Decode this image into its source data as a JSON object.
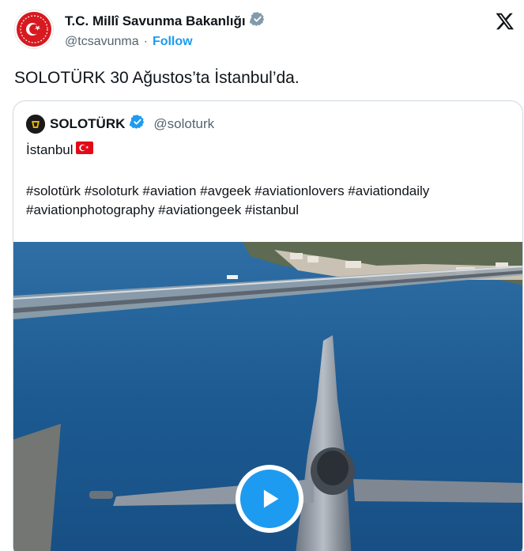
{
  "author": {
    "display_name": "T.C. Millî Savunma Bakanlığı",
    "handle": "@tcsavunma",
    "separator": "·",
    "follow_label": "Follow"
  },
  "tweet": {
    "text": "SOLOTÜRK 30 Ağustos’ta İstanbul’da."
  },
  "quoted": {
    "display_name": "SOLOTÜRK",
    "handle": "@soloturk",
    "line1": "İstanbul",
    "hashtags_line1": "#solotürk #soloturk #aviation #avgeek #aviationlovers #aviationdaily",
    "hashtags_line2": "#aviationphotography #aviationgeek #istanbul"
  },
  "icons": {
    "verified": "verified-badge-icon",
    "x_logo": "x-logo-icon",
    "flag": "turkey-flag-icon",
    "play": "play-icon"
  },
  "colors": {
    "accent": "#1d9bf0",
    "text": "#0f1419",
    "muted": "#536471",
    "border": "#cfd9de",
    "flag_red": "#e30a17"
  }
}
